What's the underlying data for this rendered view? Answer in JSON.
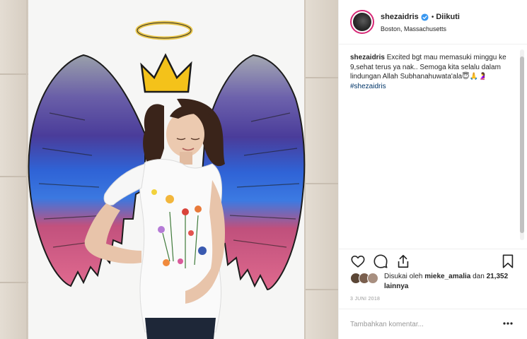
{
  "post": {
    "image_alt": "",
    "username": "shezaidris",
    "verified": true,
    "separator": "•",
    "follow_label": "Diikuti",
    "location": "Boston, Massachusetts"
  },
  "caption": {
    "username": "shezaidris",
    "text": "Excited bgt mau memasuki minggu ke 9,sehat terus ya nak.. Semoga kita selalu dalam lindungan Allah Subhanahuwata'ala",
    "emojis": "😇🙏🤰",
    "hashtag": "#shezaidris"
  },
  "actions": {
    "like_icon": "heart-icon",
    "comment_icon": "comment-icon",
    "share_icon": "share-icon",
    "save_icon": "bookmark-icon"
  },
  "likes": {
    "prefix": "Disukai oleh",
    "user": "mieke_amalia",
    "and": "dan",
    "count": "21,352 lainnya"
  },
  "date": "3 JUNI 2018",
  "comment": {
    "placeholder": "Tambahkan komentar...",
    "more_icon": "more-options-icon"
  },
  "colors": {
    "story_ring": "#d62976",
    "verified_blue": "#3897f0",
    "hashtag": "#003569",
    "border": "#efefef"
  }
}
